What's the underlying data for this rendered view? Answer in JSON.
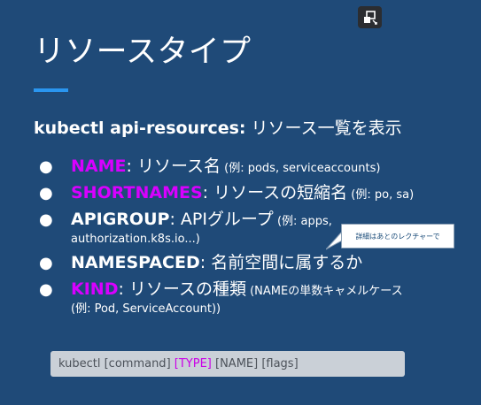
{
  "slide": {
    "title": "リソースタイプ",
    "command_heading_bold": "kubectl api-resources:",
    "command_heading_desc": " リソース一覧を表示",
    "items": [
      {
        "term": "NAME",
        "desc": ": リソース名",
        "note": " (例: pods, serviceaccounts)",
        "color": "magenta"
      },
      {
        "term": "SHORTNAMES",
        "desc": ": リソースの短縮名",
        "note": " (例: po, sa)",
        "color": "magenta"
      },
      {
        "term": "APIGROUP",
        "desc": ": APIグループ",
        "note": " (例: apps,",
        "continuation": "authorization.k8s.io...)",
        "color": "white"
      },
      {
        "term": "NAMESPACED",
        "desc": ": 名前空間に属するか",
        "note": "",
        "color": "white"
      },
      {
        "term": "KIND",
        "desc": ": リソースの種類",
        "note": " (NAMEの単数キャメルケース",
        "continuation": "(例: Pod, ServiceAccount))",
        "color": "magenta"
      }
    ],
    "bubble_text": "詳細はあとのレクチャーで",
    "usage": {
      "prefix": "kubectl [command] ",
      "type": "[TYPE]",
      "suffix": " [NAME] [flags]"
    }
  },
  "icons": {
    "exit_button": "exit-fullscreen-icon",
    "bullet": "filled-circle-bullet-icon",
    "callout_tail": "speech-bubble-tail-icon"
  },
  "colors": {
    "background": "#1f4a78",
    "accent_underline": "#2a96f0",
    "magenta": "#d800ff",
    "usage_box": "#cad0d7"
  }
}
